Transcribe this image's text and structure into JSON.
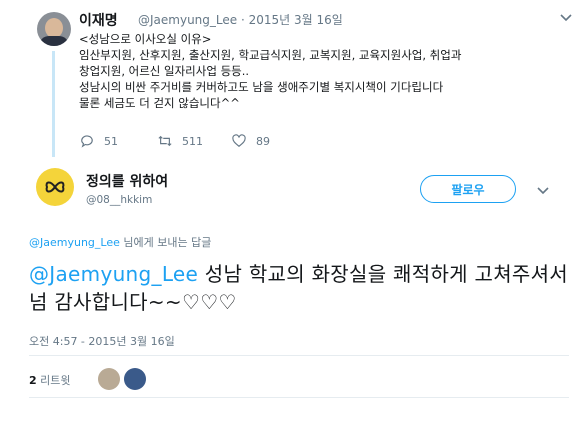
{
  "original": {
    "name": "이재명",
    "handle_date": "@Jaemyung_Lee · 2015년 3월 16일",
    "body": "<성남으로 이사오실 이유>\n임산부지원, 산후지원, 출산지원, 학교급식지원, 교복지원, 교육지원사업, 취업과\n창업지원, 어르신 일자리사업 등등..\n성남시의 비싼 주거비를 커버하고도 남을 생애주기별 복지시책이 기다립니다\n물론 세금도 더 걷지 않습니다^^",
    "replies": "51",
    "retweets": "511",
    "likes": "89"
  },
  "reply": {
    "name": "정의를 위하여",
    "handle": "@08__hkkim",
    "follow_label": "팔로우",
    "reply_to_handle": "@Jaemyung_Lee",
    "reply_to_suffix": " 님에게 보내는 답글",
    "mention": "@Jaemyung_Lee",
    "text": " 성남 학교의 화장실을 쾌적하게 고쳐주셔서 넘 감사합니다~~♡♡♡",
    "timestamp": "오전 4:57 - 2015년 3월 16일",
    "retweet_count": "2",
    "retweet_label": " 리트윗"
  },
  "colors": {
    "accent": "#1da1f2",
    "muted": "#657786",
    "thread": "#c8e6f7"
  }
}
